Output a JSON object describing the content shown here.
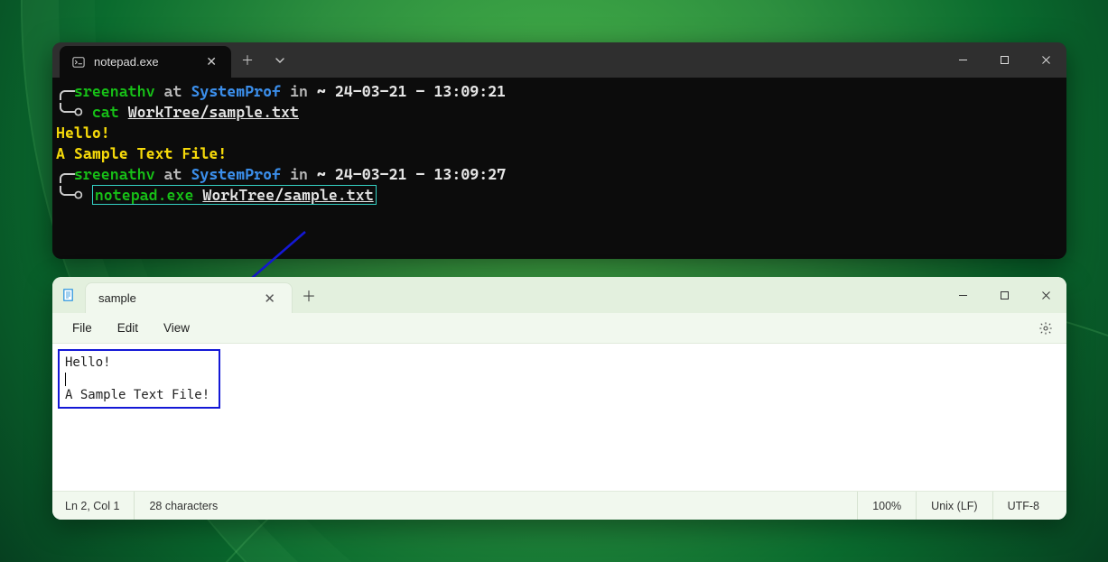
{
  "terminal": {
    "tab": {
      "title": "notepad.exe"
    },
    "prompt1": {
      "user": "sreenathv",
      "at": "at",
      "host": "SystemProf",
      "in": "in",
      "path": "~",
      "date": "24-03-21",
      "dash": "–",
      "time": "13:09:21",
      "cmd": "cat",
      "arg": "WorkTree/sample.txt"
    },
    "output": {
      "line1": "Hello!",
      "line2": "",
      "line3": "A Sample Text File!"
    },
    "prompt2": {
      "user": "sreenathv",
      "at": "at",
      "host": "SystemProf",
      "in": "in",
      "path": "~",
      "date": "24-03-21",
      "dash": "–",
      "time": "13:09:27",
      "cmd": "notepad.exe",
      "arg": "WorkTree/sample.txt"
    }
  },
  "notepad": {
    "tab": {
      "title": "sample"
    },
    "menu": {
      "file": "File",
      "edit": "Edit",
      "view": "View"
    },
    "content": {
      "line1": "Hello!",
      "line2": "",
      "line3": "A Sample Text File!"
    },
    "status": {
      "pos": "Ln 2, Col 1",
      "chars": "28 characters",
      "zoom": "100%",
      "eol": "Unix (LF)",
      "encoding": "UTF-8"
    }
  }
}
